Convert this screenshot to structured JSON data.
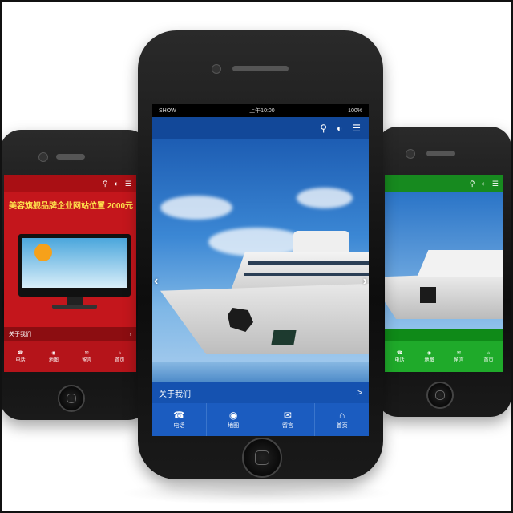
{
  "center_phone": {
    "status_bar": {
      "carrier": "SHOW",
      "time": "上午10:00",
      "battery": "100%"
    },
    "top_icons": [
      "search-icon",
      "contrast-icon",
      "menu-icon"
    ],
    "about_label": "关于我们",
    "about_arrow": ">",
    "nav": [
      {
        "icon": "phone-icon",
        "label": "电话"
      },
      {
        "icon": "location-icon",
        "label": "地图"
      },
      {
        "icon": "message-icon",
        "label": "留言"
      },
      {
        "icon": "home-icon",
        "label": "首页"
      }
    ]
  },
  "left_phone": {
    "banner_text": "美容旗舰品牌企业网站位置 2000元",
    "about_label": "关于我们",
    "nav": [
      "电话",
      "地图",
      "留言",
      "首页"
    ]
  },
  "right_phone": {
    "nav": [
      "电话",
      "地图",
      "留言",
      "首页"
    ]
  },
  "colors": {
    "center_theme": "#1552b0",
    "left_theme": "#c4161c",
    "right_theme": "#1faa2a"
  }
}
